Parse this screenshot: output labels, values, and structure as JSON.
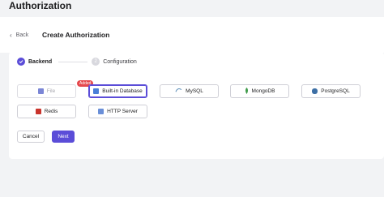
{
  "page": {
    "title": "Authorization"
  },
  "header": {
    "back_label": "Back",
    "title": "Create Authorization"
  },
  "steps": [
    {
      "label": "Backend",
      "number": "1",
      "status": "active"
    },
    {
      "label": "Configuration",
      "number": "2",
      "status": "pending"
    }
  ],
  "backends": [
    {
      "label": "File",
      "icon": "file-icon",
      "state": "disabled",
      "badge": "Added"
    },
    {
      "label": "Built-in Database",
      "icon": "database-icon",
      "state": "selected"
    },
    {
      "label": "MySQL",
      "icon": "mysql-icon",
      "state": "normal"
    },
    {
      "label": "MongoDB",
      "icon": "mongodb-icon",
      "state": "normal"
    },
    {
      "label": "PostgreSQL",
      "icon": "postgresql-icon",
      "state": "normal"
    },
    {
      "label": "Redis",
      "icon": "redis-icon",
      "state": "normal"
    },
    {
      "label": "HTTP Server",
      "icon": "http-server-icon",
      "state": "normal"
    }
  ],
  "actions": {
    "cancel_label": "Cancel",
    "next_label": "Next"
  },
  "colors": {
    "accent": "#5b4dd8",
    "badge": "#e5484d"
  }
}
